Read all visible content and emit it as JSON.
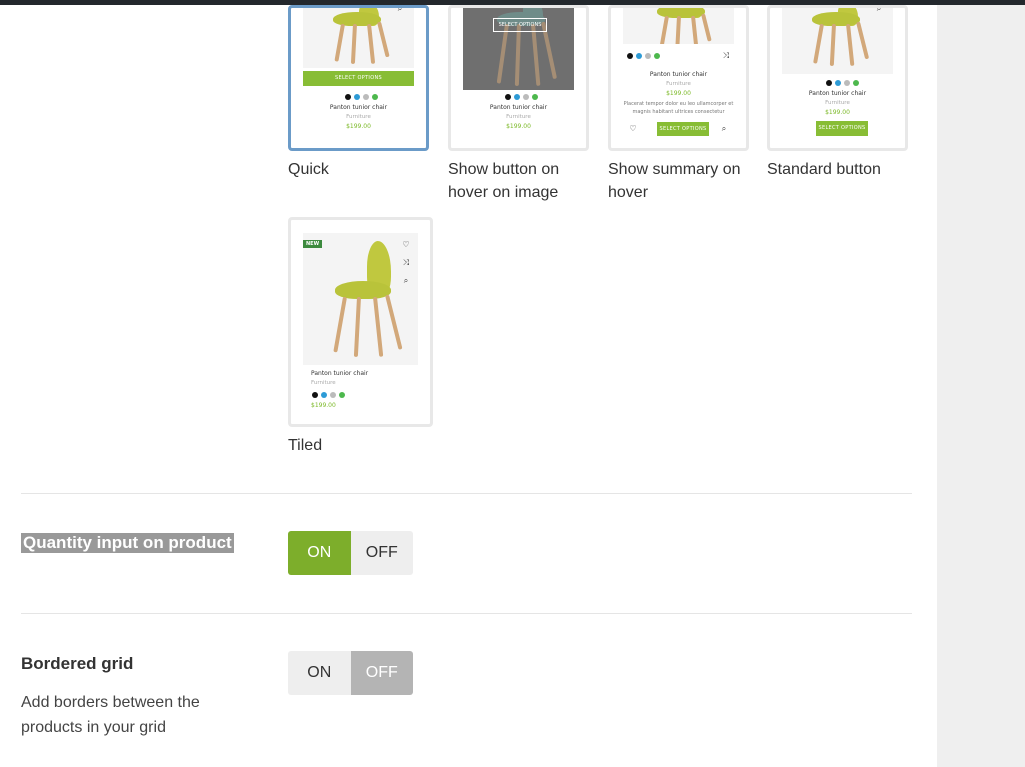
{
  "layouts": [
    {
      "label": "Quick",
      "selected": true,
      "button": "SELECT OPTIONS"
    },
    {
      "label": "Show button on hover on image",
      "selected": false,
      "button": "SELECT OPTIONS"
    },
    {
      "label": "Show summary on hover",
      "selected": false,
      "button": "SELECT OPTIONS",
      "summary": "Placerat tempor dolor eu leo ullamcorper et magnis habitant ultrices consectetur"
    },
    {
      "label": "Standard button",
      "selected": false,
      "button": "SELECT OPTIONS"
    },
    {
      "label": "Tiled",
      "selected": false,
      "badge": "NEW"
    }
  ],
  "product": {
    "title": "Panton tunior chair",
    "category": "Furniture",
    "price": "$199.00"
  },
  "swatch_colors": [
    "#111111",
    "#2d9bd6",
    "#bbbbbb",
    "#4db84d"
  ],
  "quantity": {
    "title": "Quantity input on product",
    "on": "ON",
    "off": "OFF",
    "value": "on"
  },
  "bordered": {
    "title": "Bordered grid",
    "description": "Add borders between the products in your grid",
    "on": "ON",
    "off": "OFF",
    "value": "off"
  },
  "colors": {
    "accent_green": "#7dae2b",
    "selected_border": "#6b9bc8"
  }
}
